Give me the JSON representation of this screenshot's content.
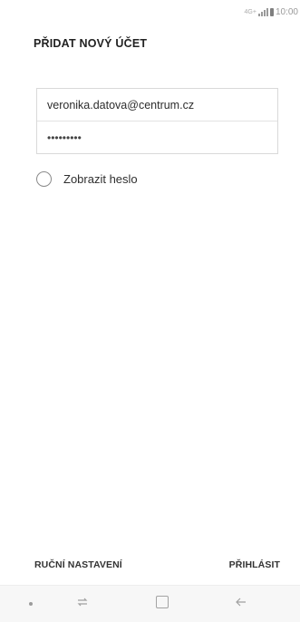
{
  "status_bar": {
    "network_label": "4G+",
    "time": "10:00"
  },
  "header": {
    "title": "PŘIDAT NOVÝ ÚČET"
  },
  "form": {
    "email_value": "veronika.datova@centrum.cz",
    "password_value": "•••••••••"
  },
  "show_password": {
    "label": "Zobrazit heslo",
    "checked": false
  },
  "footer": {
    "manual_button": "RUČNÍ NASTAVENÍ",
    "login_button": "PŘIHLÁSIT"
  },
  "nav_bar": {
    "icons": [
      "dot-icon",
      "recent-apps-icon",
      "home-icon",
      "back-icon"
    ]
  }
}
